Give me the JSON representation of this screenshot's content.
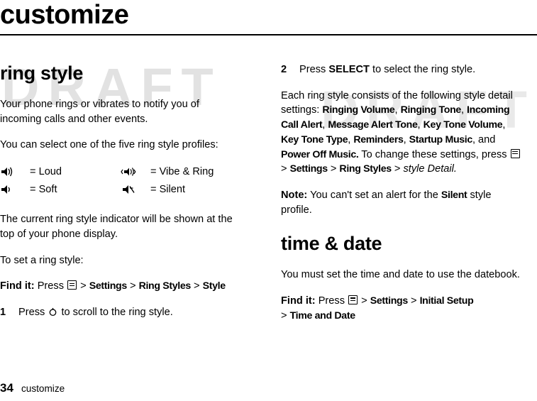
{
  "watermark": {
    "text1": "DRAFT",
    "text2": "DRAFT"
  },
  "header": {
    "chapter_title": "customize"
  },
  "footer": {
    "page_number": "34",
    "chapter": "customize"
  },
  "left_column": {
    "section_title": "ring style",
    "intro": "Your phone rings or vibrates to notify you of incoming calls and other events.",
    "select_profiles": "You can select one of the five ring style profiles:",
    "profiles": [
      {
        "icon": "loud-speaker-icon",
        "equals": "= Loud"
      },
      {
        "icon": "vibe-and-ring-icon",
        "equals": "= Vibe & Ring"
      },
      {
        "icon": "soft-speaker-icon",
        "equals": "= Soft"
      },
      {
        "icon": "silent-icon",
        "equals": "= Silent"
      }
    ],
    "indicator_note": "The current ring style indicator will be shown at the top of your phone display.",
    "to_set": "To set a ring style:",
    "find_it_label": "Find it:",
    "find_it_press": "Press",
    "find_it_menu_icon": "menu-key-icon",
    "find_it_path_1": ">",
    "find_it_settings": "Settings",
    "find_it_path_2": ">",
    "find_it_ringstyles": "Ring Styles",
    "find_it_path_3": ">",
    "find_it_style": "Style",
    "step1_number": "1",
    "step1_before": "Press",
    "step1_nav_icon": "navigation-key-icon",
    "step1_after": "to scroll to the ring style."
  },
  "right_column": {
    "step2_number": "2",
    "step2_before": "Press",
    "step2_bold": "SELECT",
    "step2_after": "to select the ring style.",
    "detail_intro": "Each ring style consists of the following style detail settings:",
    "detail_settings": [
      "Ringing Volume",
      "Ringing Tone",
      "Incoming Call Alert",
      "Message Alert Tone",
      "Key Tone Volume",
      "Key Tone Type",
      "Reminders",
      "Startup Music",
      "Power Off Music."
    ],
    "detail_and": "and",
    "detail_change": "To change these settings, press",
    "detail_menu_icon": "menu-key-icon",
    "detail_path_1": ">",
    "detail_settings_word": "Settings",
    "detail_path_2": ">",
    "detail_ringstyles": "Ring Styles",
    "detail_path_3": ">",
    "detail_styledetail": "style Detail.",
    "note_label": "Note:",
    "note_text_1": "You can't set an alert for the",
    "note_silent": "Silent",
    "note_text_2": "style profile.",
    "section2_title": "time & date",
    "section2_intro": "You must set the time and date to use the datebook.",
    "find_it_label": "Find it:",
    "find_it_press": "Press",
    "find_it_menu_icon": "menu-key-icon",
    "find_it_path_1": ">",
    "find_it_settings": "Settings",
    "find_it_path_2": ">",
    "find_it_initialsetup": "Initial Setup",
    "find_it_path_3": ">",
    "find_it_timeanddate": "Time and Date"
  }
}
